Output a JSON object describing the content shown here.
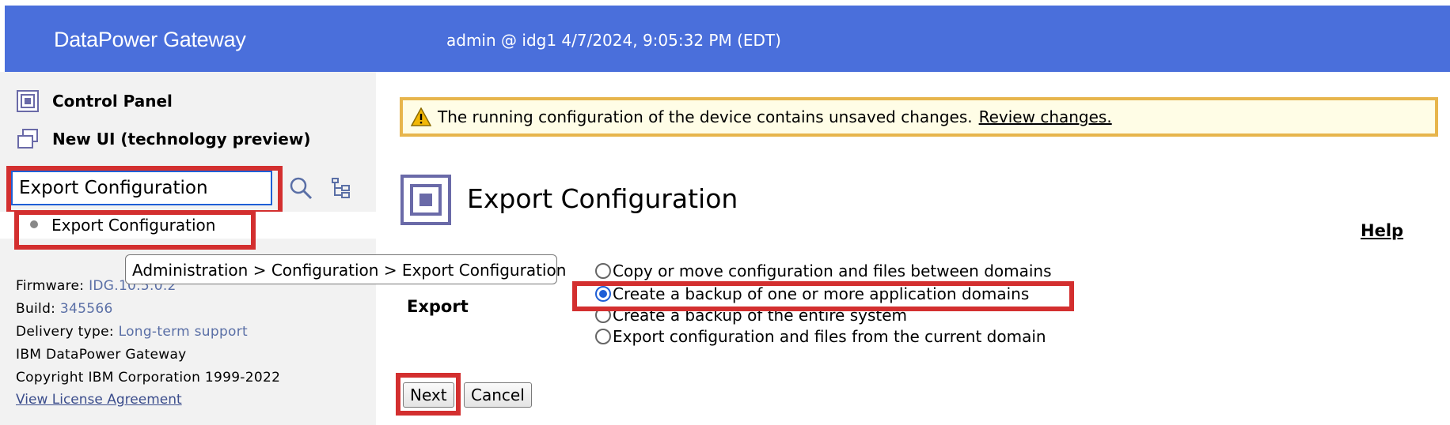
{
  "header": {
    "brand": "DataPower Gateway",
    "user_info": "admin @ idg1 4/7/2024, 9:05:32 PM (EDT)"
  },
  "sidebar": {
    "control_panel": "Control Panel",
    "new_ui": "New UI (technology preview)",
    "search": {
      "value": "Export Configuration"
    },
    "search_result": "Export Configuration",
    "tooltip": "Administration > Configuration > Export Configuration",
    "info": {
      "firmware_label": "Firmware:",
      "firmware_value": "IDG.10.5.0.2",
      "build_label": "Build:",
      "build_value": "345566",
      "delivery_label": "Delivery type:",
      "delivery_value": "Long-term support",
      "product": "IBM DataPower Gateway",
      "copyright": "Copyright IBM Corporation 1999-2022",
      "license_link": "View License Agreement"
    }
  },
  "main": {
    "alert_text": "The running configuration of the device contains unsaved changes.",
    "alert_link": "Review changes.",
    "page_title": "Export Configuration",
    "help": "Help",
    "export_label": "Export",
    "options": [
      {
        "label": "Copy or move configuration and files between domains",
        "checked": false
      },
      {
        "label": "Create a backup of one or more application domains",
        "checked": true
      },
      {
        "label": "Create a backup of the entire system",
        "checked": false
      },
      {
        "label": "Export configuration and files from the current domain",
        "checked": false
      }
    ],
    "next_button": "Next",
    "cancel_button": "Cancel"
  },
  "colors": {
    "header_bg": "#4a6fdb",
    "highlight": "#d32f2f",
    "alert_border": "#e7b54c",
    "alert_bg": "#fffde6",
    "link_value": "#5a6fa6"
  }
}
